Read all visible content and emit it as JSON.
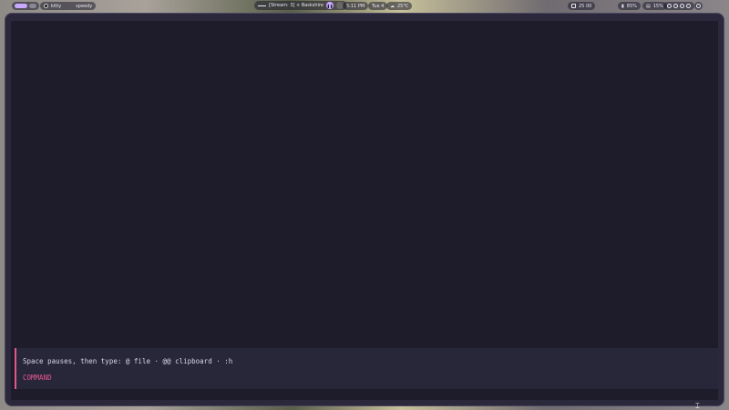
{
  "topbar": {
    "window_app": "kitty",
    "window_title": "speedy",
    "media_title": "[Stream: 3] + Baskshire",
    "time": "5:11 PM",
    "date": "Tue 4",
    "weather": "25°C",
    "calendar": "25 00",
    "battery": "85%",
    "volume": "15%"
  },
  "terminal": {
    "hint": "Space pauses, then type: @ file · @@ clipboard · :h",
    "mode": "COMMAND"
  },
  "colors": {
    "accent": "#c9a8ff",
    "command_accent": "#e0588e",
    "terminal_bg": "#1e1c2a",
    "panel_bg": "#282739"
  }
}
